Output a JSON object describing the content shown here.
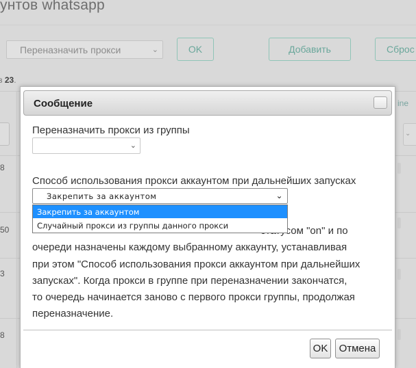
{
  "background": {
    "page_title": "унтов whatsapp",
    "bulk_select_value": "Переназначить прокси",
    "ok_label": "OK",
    "add_label": "Добавить",
    "reset_label": "Сброс",
    "count_prefix": "з ",
    "count_value": "23",
    "count_suffix": ".",
    "right_link": "ine",
    "row_numbers": [
      "8",
      "50",
      "3",
      "8"
    ]
  },
  "dialog": {
    "title": "Сообщение",
    "group_label": "Переназначить прокси из группы",
    "group_select_value": "",
    "mode_label": "Способ использования прокси аккаунтом при дальнейших запусках",
    "mode_select_value": "Закрепить за аккаунтом",
    "mode_options": [
      {
        "label": "Закрепить за аккаунтом",
        "selected": true
      },
      {
        "label": "Случайный прокси из группы данного прокси",
        "selected": false
      }
    ],
    "description_lines": [
      "статусом \"on\" и по",
      "очереди назначены каждому выбранному аккаунту, устанавливая",
      "при этом \"Способ использования прокси аккаунтом при дальнейших",
      "запусках\". Когда прокси в группе при переназначении закончатся,",
      "то очередь начинается заново с первого прокси группы, продолжая",
      "переназначение."
    ],
    "ok_label": "OK",
    "cancel_label": "Отмена"
  },
  "colors": {
    "accent_teal": "#6aa79b",
    "selection_blue": "#1e90ff",
    "overlay": "#d9d9d9"
  },
  "icons": [
    "chevron-down-icon",
    "close-icon"
  ]
}
